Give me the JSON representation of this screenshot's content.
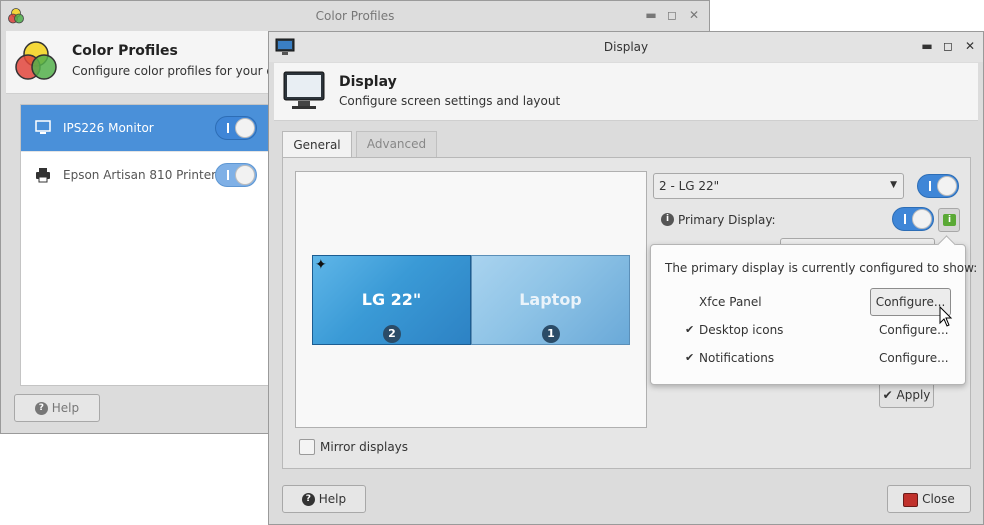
{
  "color_profiles": {
    "window_title": "Color Profiles",
    "header_title": "Color Profiles",
    "header_subtitle": "Configure color profiles for your devices",
    "devices": [
      {
        "label": "IPS226 Monitor",
        "enabled": true,
        "selected": true
      },
      {
        "label": "Epson Artisan 810 Printer",
        "enabled": true,
        "selected": false
      }
    ],
    "help_label": "Help"
  },
  "display": {
    "window_title": "Display",
    "header_title": "Display",
    "header_subtitle": "Configure screen settings and layout",
    "tabs": [
      {
        "label": "General",
        "active": true
      },
      {
        "label": "Advanced",
        "active": false
      }
    ],
    "monitors": [
      {
        "label": "LG 22\"",
        "number": "1 2",
        "primary": true
      },
      {
        "label": "Laptop",
        "number": "1",
        "primary": false
      }
    ],
    "display_select_value": "2 - LG 22\"",
    "display_enabled": true,
    "primary_display_label": "Primary Display:",
    "primary_display_enabled": true,
    "mirror_label": "Mirror displays",
    "mirror_checked": false,
    "apply_label": "Apply",
    "help_label": "Help",
    "close_label": "Close",
    "popover": {
      "message": "The primary display is currently configured to show:",
      "rows": [
        {
          "label": "Xfce Panel",
          "checked": false,
          "action": "Configure..."
        },
        {
          "label": "Desktop icons",
          "checked": true,
          "action": "Configure..."
        },
        {
          "label": "Notifications",
          "checked": true,
          "action": "Configure..."
        }
      ]
    }
  },
  "colors": {
    "accent": "#3f86d7",
    "selection": "#4a90d9"
  }
}
